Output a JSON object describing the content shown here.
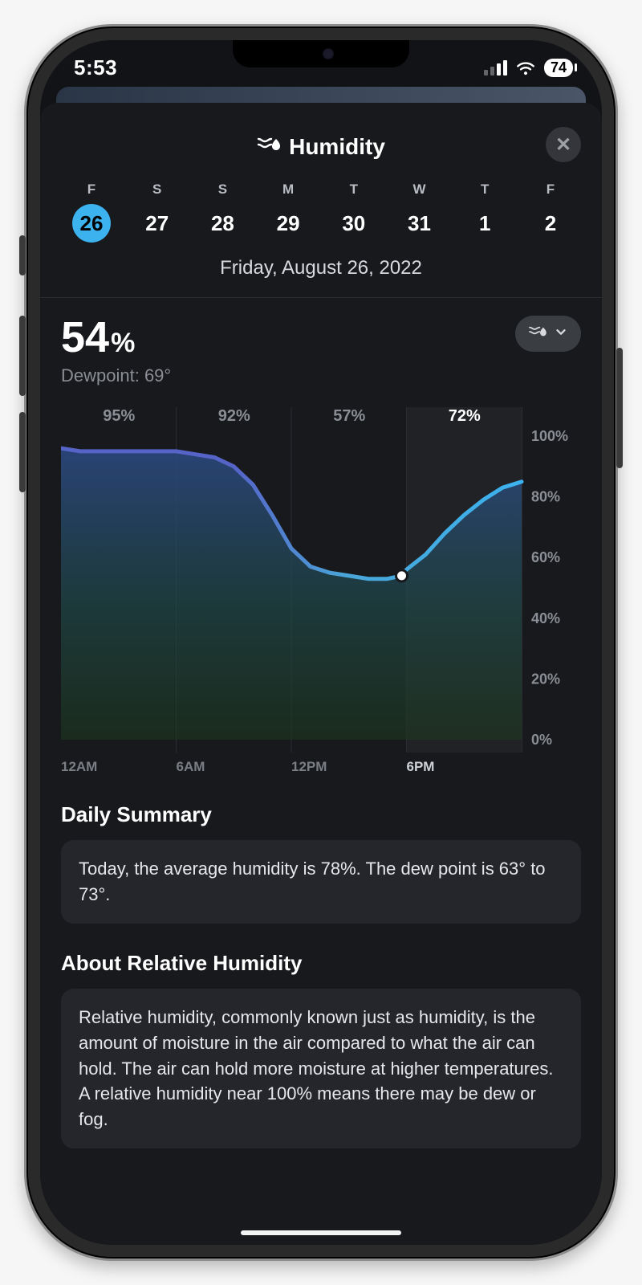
{
  "status_bar": {
    "time": "5:53",
    "battery": "74"
  },
  "header": {
    "title": "Humidity"
  },
  "picker": {
    "days": [
      {
        "dow": "F",
        "num": "26",
        "selected": true
      },
      {
        "dow": "S",
        "num": "27",
        "selected": false
      },
      {
        "dow": "S",
        "num": "28",
        "selected": false
      },
      {
        "dow": "M",
        "num": "29",
        "selected": false
      },
      {
        "dow": "T",
        "num": "30",
        "selected": false
      },
      {
        "dow": "W",
        "num": "31",
        "selected": false
      },
      {
        "dow": "T",
        "num": "1",
        "selected": false
      },
      {
        "dow": "F",
        "num": "2",
        "selected": false
      }
    ],
    "full_date": "Friday, August 26, 2022"
  },
  "current": {
    "value": "54",
    "unit": "%",
    "dewpoint_label": "Dewpoint: 69°"
  },
  "chart_data": {
    "type": "line",
    "x_labels": [
      "12AM",
      "6AM",
      "12PM",
      "6PM"
    ],
    "y_ticks": [
      "100%",
      "80%",
      "60%",
      "40%",
      "20%",
      "0%"
    ],
    "ylim": [
      0,
      100
    ],
    "segment_labels": [
      "95%",
      "92%",
      "57%",
      "72%"
    ],
    "highlight_segment_index": 3,
    "now_hour": 17.75,
    "now_value": 54,
    "series": [
      {
        "name": "humidity",
        "x": [
          0,
          1,
          2,
          3,
          4,
          5,
          6,
          7,
          8,
          9,
          10,
          11,
          12,
          13,
          14,
          15,
          16,
          17,
          17.75,
          18,
          19,
          20,
          21,
          22,
          23,
          24
        ],
        "y": [
          96,
          95,
          95,
          95,
          95,
          95,
          95,
          94,
          93,
          90,
          84,
          74,
          63,
          57,
          55,
          54,
          53,
          53,
          54,
          56,
          61,
          68,
          74,
          79,
          83,
          85
        ]
      }
    ]
  },
  "summary": {
    "heading": "Daily Summary",
    "body": "Today, the average humidity is 78%. The dew point is 63° to 73°."
  },
  "about": {
    "heading": "About Relative Humidity",
    "body": "Relative humidity, commonly known just as humidity, is the amount of moisture in the air compared to what the air can hold. The air can hold more moisture at higher temperatures. A relative humidity near 100% means there may be dew or fog."
  }
}
